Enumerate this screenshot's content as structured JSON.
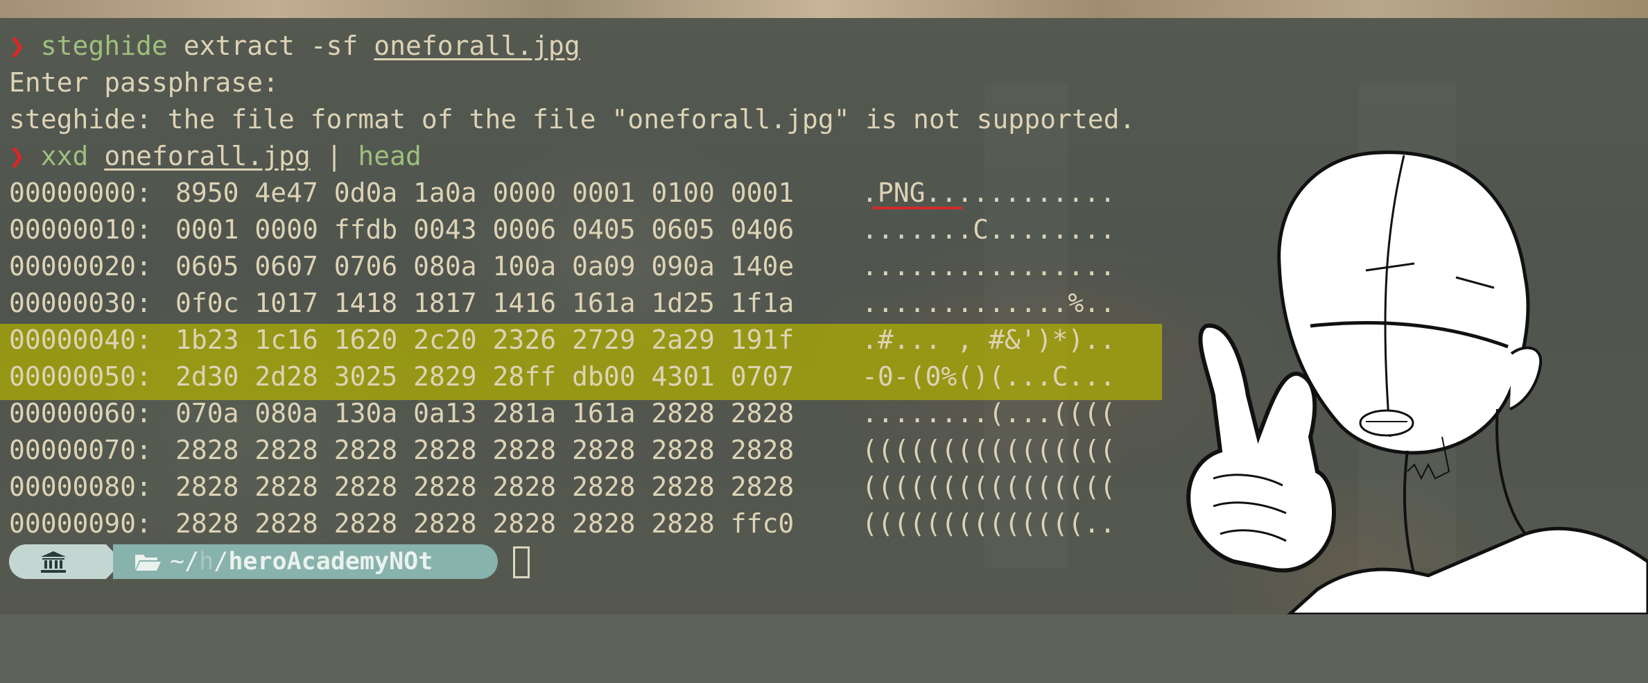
{
  "prompt_symbol": "❯",
  "line1": {
    "cmd": "steghide",
    "args": " extract -sf ",
    "file": "oneforall.jpg"
  },
  "line2": {
    "text": "Enter passphrase:"
  },
  "line3": {
    "text": "steghide: the file format of the file \"oneforall.jpg\" is not supported."
  },
  "line4": {
    "cmd": "xxd",
    "file": "oneforall.jpg",
    "pipe": " | ",
    "cmd2": "head"
  },
  "hexdump": [
    {
      "offset": "00000000:",
      "hex": "8950 4e47 0d0a 1a0a 0000 0001 0100 0001",
      "ascii": ".PNG............"
    },
    {
      "offset": "00000010:",
      "hex": "0001 0000 ffdb 0043 0006 0405 0605 0406",
      "ascii": ".......C........"
    },
    {
      "offset": "00000020:",
      "hex": "0605 0607 0706 080a 100a 0a09 090a 140e",
      "ascii": "................"
    },
    {
      "offset": "00000030:",
      "hex": "0f0c 1017 1418 1817 1416 161a 1d25 1f1a",
      "ascii": ".............%.."
    },
    {
      "offset": "00000040:",
      "hex": "1b23 1c16 1620 2c20 2326 2729 2a29 191f",
      "ascii": ".#... , #&')*).."
    },
    {
      "offset": "00000050:",
      "hex": "2d30 2d28 3025 2829 28ff db00 4301 0707",
      "ascii": "-0-(0%()(...C..."
    },
    {
      "offset": "00000060:",
      "hex": "070a 080a 130a 0a13 281a 161a 2828 2828",
      "ascii": "........(...(((("
    },
    {
      "offset": "00000070:",
      "hex": "2828 2828 2828 2828 2828 2828 2828 2828",
      "ascii": "(((((((((((((((("
    },
    {
      "offset": "00000080:",
      "hex": "2828 2828 2828 2828 2828 2828 2828 2828",
      "ascii": "(((((((((((((((("
    },
    {
      "offset": "00000090:",
      "hex": "2828 2828 2828 2828 2828 2828 2828 ffc0",
      "ascii": "((((((((((((((.."
    }
  ],
  "statusbar": {
    "home_icon": "bank-icon",
    "folder_icon": "folder-open-icon",
    "path_prefix": "~/",
    "path_dim": "h",
    "path_sep": "/",
    "path_name": "heroAcademyNOt"
  },
  "colors": {
    "prompt_arrow": "#e02424",
    "command": "#9ec07e",
    "output": "#ddd3b6",
    "highlight": "#b0b000",
    "powerline_home": "#c3d6d1",
    "powerline_path": "#88b2ac"
  }
}
